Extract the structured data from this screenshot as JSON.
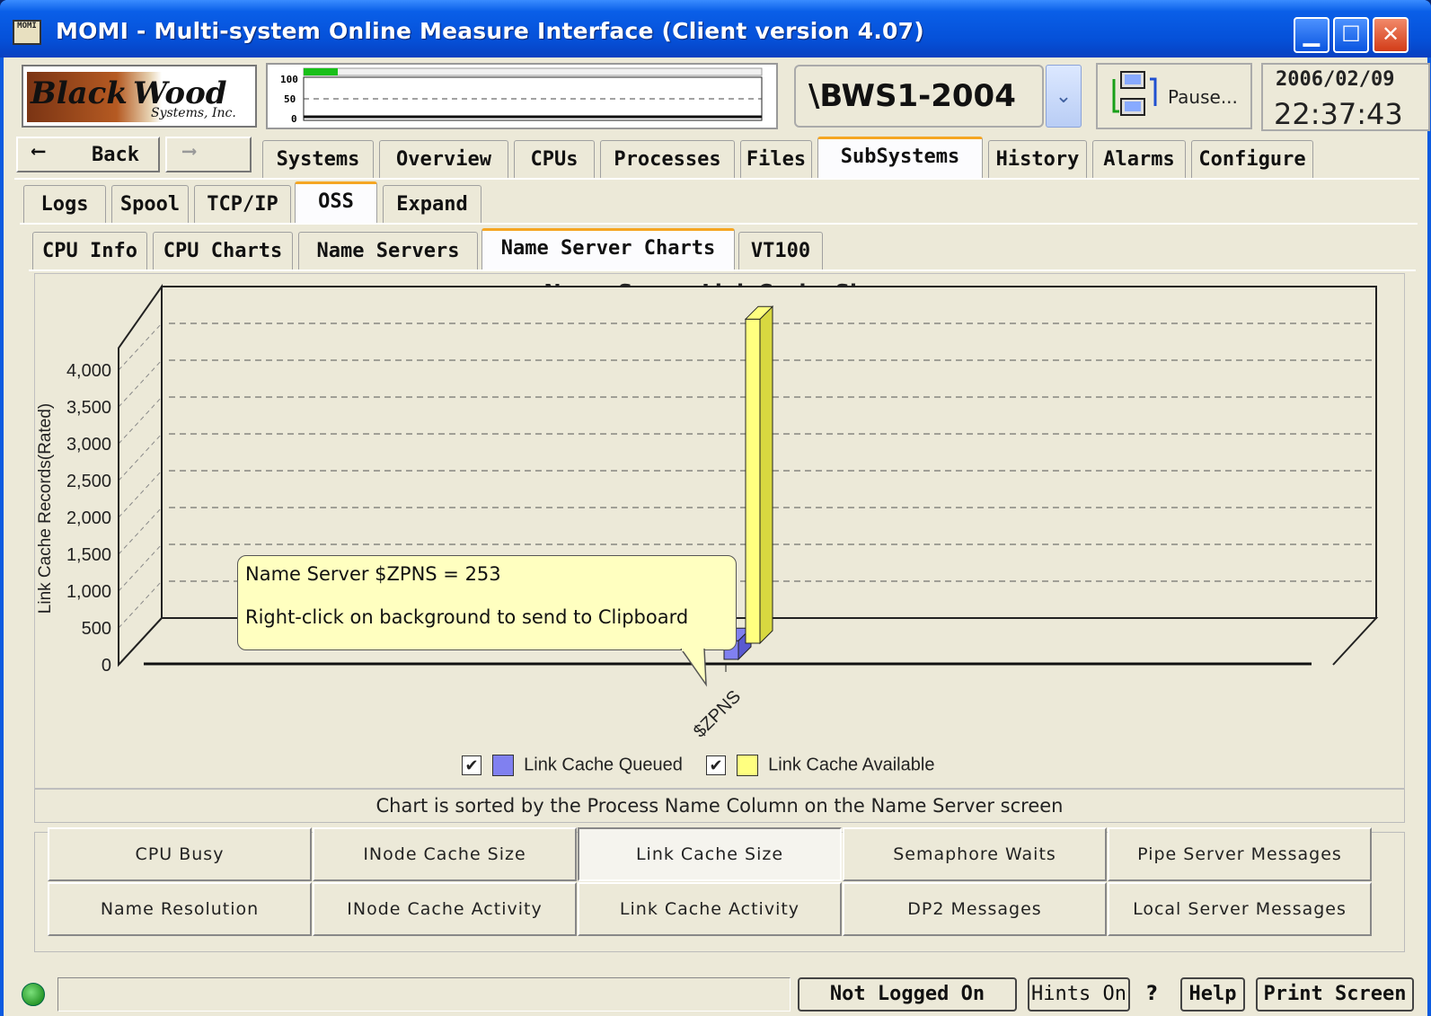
{
  "window": {
    "title": "MOMI - Multi-system Online Measure Interface (Client version 4.07)",
    "icon_label": "MOMI"
  },
  "header": {
    "logo_line1": "Black",
    "logo_line2": "Wood",
    "logo_line3": "Systems, Inc.",
    "mini_chart": {
      "y_ticks": [
        "100",
        "50",
        "0"
      ]
    },
    "system_name": "\\BWS1-2004",
    "pause_label": "Pause...",
    "date": "2006/02/09",
    "time": "22:37:43"
  },
  "nav": {
    "back_label": "Back",
    "main_tabs": [
      {
        "label": "Systems"
      },
      {
        "label": "Overview"
      },
      {
        "label": "CPUs"
      },
      {
        "label": "Processes"
      },
      {
        "label": "Files"
      },
      {
        "label": "SubSystems"
      },
      {
        "label": "History"
      },
      {
        "label": "Alarms"
      },
      {
        "label": "Configure"
      }
    ],
    "active_main_tab": "SubSystems",
    "sub_tabs": [
      {
        "label": "Logs"
      },
      {
        "label": "Spool"
      },
      {
        "label": "TCP/IP"
      },
      {
        "label": "OSS"
      },
      {
        "label": "Expand"
      }
    ],
    "active_sub_tab": "OSS",
    "oss_tabs": [
      {
        "label": "CPU Info"
      },
      {
        "label": "CPU Charts"
      },
      {
        "label": "Name Servers"
      },
      {
        "label": "Name Server Charts"
      },
      {
        "label": "VT100"
      }
    ],
    "active_oss_tab": "Name Server Charts"
  },
  "chart_data": {
    "type": "bar",
    "title": "Name Server Link Cache Sizes",
    "ylabel": "Link Cache Records(Rated)",
    "xlabel": "",
    "categories": [
      "$ZPNS"
    ],
    "series": [
      {
        "name": "Link Cache Queued",
        "values": [
          253
        ],
        "color": "#8080f0"
      },
      {
        "name": "Link Cache Available",
        "values": [
          4400
        ],
        "color": "#ffff80"
      }
    ],
    "y_ticks": [
      "4,000",
      "3,500",
      "3,000",
      "2,500",
      "2,000",
      "1,500",
      "1,000",
      "500",
      "0"
    ],
    "ylim": [
      0,
      4500
    ],
    "grid": true,
    "legend_position": "bottom"
  },
  "tooltip": {
    "line1": "Name Server $ZPNS = 253",
    "line2": "Right-click on background to send to Clipboard"
  },
  "legend": {
    "queued_checked": "✔",
    "available_checked": "✔"
  },
  "sort_note": "Chart is sorted by the Process Name Column on the Name Server screen",
  "chart_buttons": [
    {
      "label": "CPU Busy"
    },
    {
      "label": "INode Cache Size"
    },
    {
      "label": "Link Cache Size"
    },
    {
      "label": "Semaphore Waits"
    },
    {
      "label": "Pipe Server Messages"
    },
    {
      "label": "Name Resolution"
    },
    {
      "label": "INode Cache Activity"
    },
    {
      "label": "Link Cache Activity"
    },
    {
      "label": "DP2 Messages"
    },
    {
      "label": "Local Server  Messages"
    }
  ],
  "active_chart_button": "Link Cache Size",
  "statusbar": {
    "login_label": "Not Logged On",
    "hints_label": "Hints On",
    "question": "?",
    "help_label": "Help",
    "print_label": "Print Screen"
  }
}
